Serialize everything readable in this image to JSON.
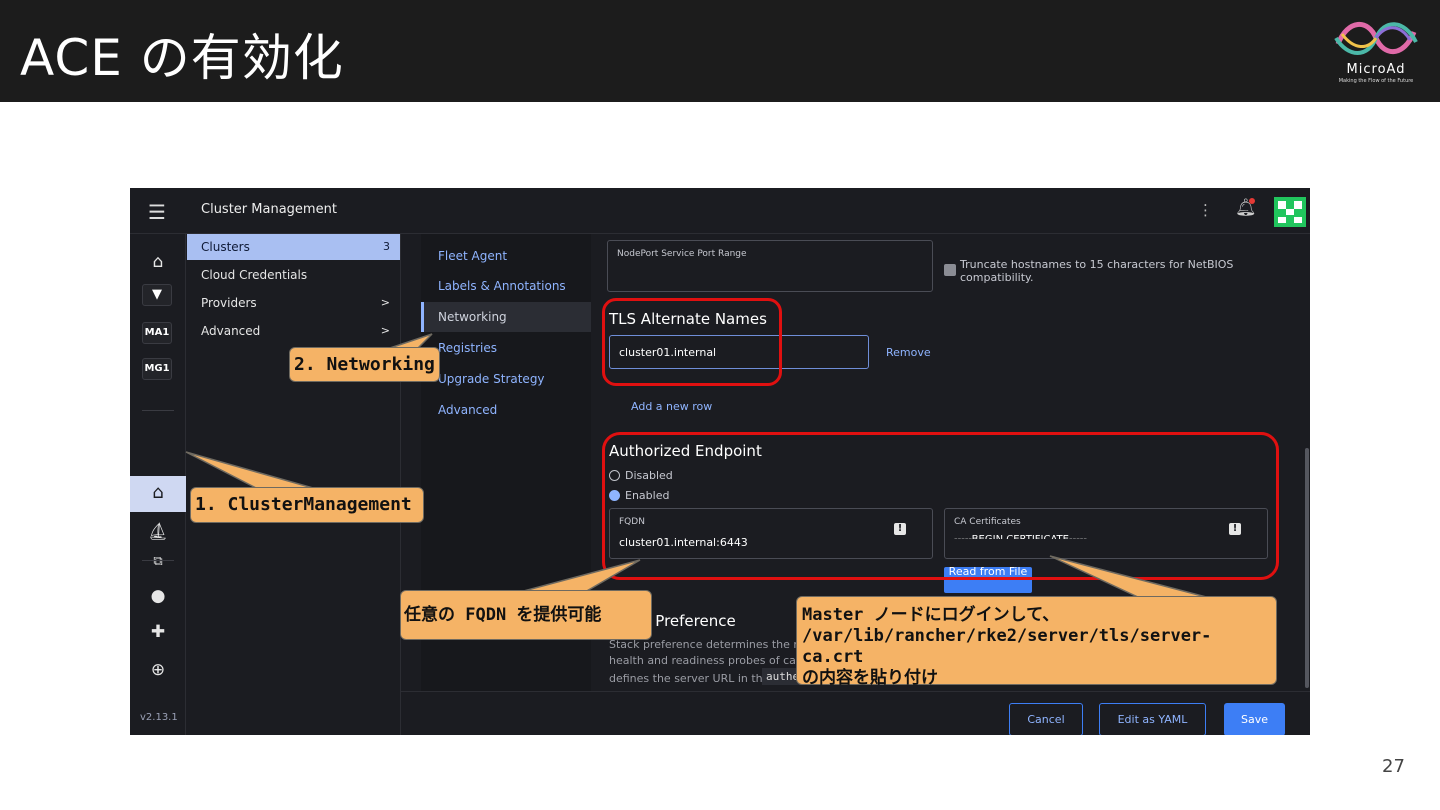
{
  "slide": {
    "title": "ACE の有効化",
    "page_number": "27",
    "logo": {
      "text": "MicroAd",
      "subtext": "Making the Flow of the Future"
    }
  },
  "app": {
    "title": "Cluster Management",
    "version": "v2.13.1",
    "rail": {
      "badges": [
        "MA1",
        "MG1"
      ]
    },
    "side_menu": [
      {
        "label": "Clusters",
        "count": "3"
      },
      {
        "label": "Cloud Credentials"
      },
      {
        "label": "Providers",
        "chevron": ">"
      },
      {
        "label": "Advanced",
        "chevron": ">"
      }
    ],
    "tabs": [
      "Fleet Agent",
      "Labels & Annotations",
      "Networking",
      "Registries",
      "Upgrade Strategy",
      "Advanced"
    ],
    "form": {
      "nodeport_label": "NodePort Service Port Range",
      "truncate_label": "Truncate hostnames to 15 characters for NetBIOS compatibility.",
      "tls_title": "TLS Alternate Names",
      "tls_value": "cluster01.internal",
      "remove_label": "Remove",
      "add_row_label": "Add a new row",
      "ace_title": "Authorized Endpoint",
      "disabled_label": "Disabled",
      "enabled_label": "Enabled",
      "fqdn_label": "FQDN",
      "fqdn_value": "cluster01.internal:6443",
      "ca_label": "CA Certificates",
      "ca_value": "-----BEGIN CERTIFICATE-----",
      "read_file_label": "Read from File",
      "stack_title": "Stack Preference",
      "stack_desc_1": "Stack preference determines the net",
      "stack_desc_2": "health and readiness probes of calico",
      "stack_desc_3": "defines the server URL in the",
      "stack_code": "authe"
    },
    "footer": {
      "cancel": "Cancel",
      "edit_yaml": "Edit as YAML",
      "save": "Save"
    }
  },
  "annotations": {
    "cluster_mgmt": "1. ClusterManagement",
    "networking": "2. Networking",
    "fqdn_note": "任意の FQDN を提供可能",
    "master_note_1": "Master ノードにログインして、",
    "master_note_2": "/var/lib/rancher/rke2/server/tls/server-ca.crt",
    "master_note_3": "の内容を貼り付け"
  }
}
